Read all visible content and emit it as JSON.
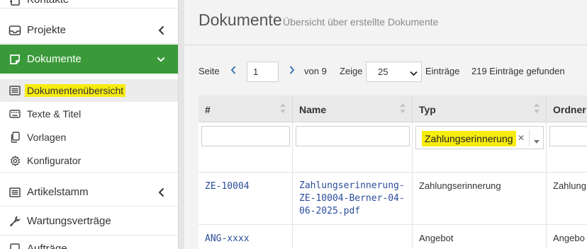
{
  "sidebar": {
    "items": [
      {
        "label": "Kontakte",
        "icon": "contacts-icon"
      },
      {
        "label": "Projekte",
        "icon": "inbox-icon"
      },
      {
        "label": "Dokumente",
        "icon": "document-icon"
      },
      {
        "label": "Dokumentenübersicht",
        "icon": "list-icon"
      },
      {
        "label": "Texte & Titel",
        "icon": "keyboard-icon"
      },
      {
        "label": "Vorlagen",
        "icon": "copy-icon"
      },
      {
        "label": "Konfigurator",
        "icon": "gear-icon"
      },
      {
        "label": "Artikelstamm",
        "icon": "list-icon"
      },
      {
        "label": "Wartungsverträge",
        "icon": "wrench-icon"
      },
      {
        "label": "Aufträge",
        "icon": "orders-icon"
      }
    ]
  },
  "header": {
    "title": "Dokumente",
    "subtitle": "Übersicht über erstellte Dokumente"
  },
  "pager": {
    "page_label": "Seite",
    "page_value": "1",
    "of_label": "von 9",
    "show_label": "Zeige",
    "per_page": "25",
    "entries_label": "Einträge",
    "found_label": "219 Einträge gefunden"
  },
  "table": {
    "columns": [
      "#",
      "Name",
      "Typ",
      "Ordner"
    ],
    "type_filter": "Zahlungserinnerung",
    "rows": [
      {
        "id": "ZE-10004",
        "name_lines": [
          "Zahlungserinnerung-",
          "ZE-10004-Berner-04-",
          "06-2025.pdf"
        ],
        "type": "Zahlungserinnerung",
        "folder": "Zahlung"
      },
      {
        "id": "ANG-xxxx",
        "name_lines": [
          "",
          "",
          ""
        ],
        "type": "Angebot",
        "folder": "Angebo"
      }
    ]
  },
  "colors": {
    "active_green": "#3a9a3a",
    "highlight_yellow": "#f7ec10",
    "link_blue": "#2a4d9b"
  }
}
